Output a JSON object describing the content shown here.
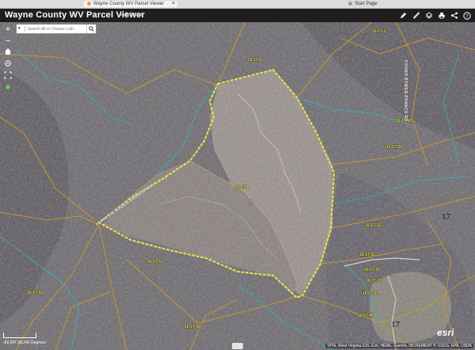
{
  "browser": {
    "tabs": [
      {
        "label": "Wayne County WV Parcel Viewer",
        "active": true
      },
      {
        "label": "Start Page",
        "active": false
      }
    ]
  },
  "header": {
    "title": "Wayne County WV Parcel Viewer",
    "subtitle": "IAS Portal",
    "tools": [
      "edit-icon",
      "measure-icon",
      "layers-icon",
      "print-icon",
      "share-icon",
      "help-icon"
    ]
  },
  "map_controls": [
    "zoom-in",
    "zoom-out",
    "home",
    "locate",
    "fullscreen",
    "basemap"
  ],
  "search": {
    "placeholder": "Search All or Choose Loth"
  },
  "parcel_labels": [
    "16-17-2",
    "16-17-9",
    "16-17-26",
    "16-17-8",
    "16-17-53",
    "16-17-52",
    "16-17-32",
    "16-17-31",
    "16-17-30",
    "16-17-33",
    "16-17-40",
    "16-17-41",
    "16-17-42",
    "16-17-37"
  ],
  "road_labels": [
    "FISHER BOWEN BRANCH RD",
    "FRANKLIN BOWEN BRANCH RD"
  ],
  "small_labels": [
    "10",
    "12"
  ],
  "district_numbers": [
    "17",
    "17"
  ],
  "footer": {
    "coords": "-82.347 38.245 Degrees",
    "attribution": "VITA, West Virginia GIS, Esri, HERE, Garmin, INCREMENT P, USGS, EPA, USDA",
    "logo": "esri"
  }
}
